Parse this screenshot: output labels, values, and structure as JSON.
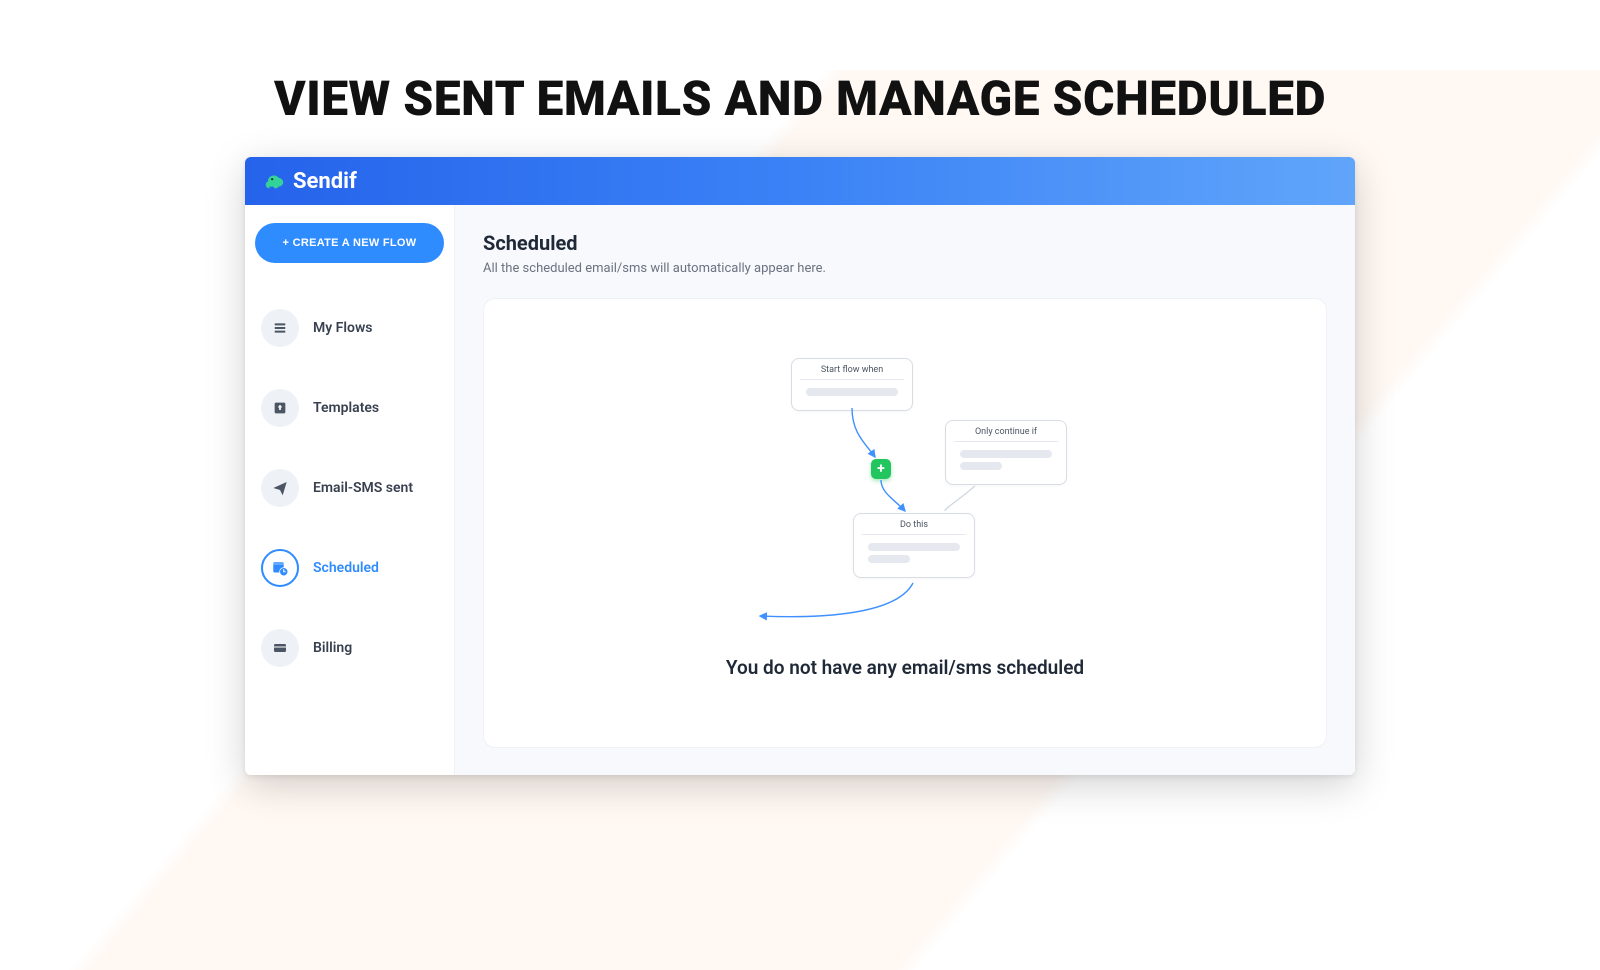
{
  "marketing": {
    "headline": "VIEW SENT EMAILS AND MANAGE SCHEDULED"
  },
  "header": {
    "brand": "Sendif"
  },
  "sidebar": {
    "create_button": "+ CREATE A NEW FLOW",
    "items": [
      {
        "id": "my-flows",
        "label": "My Flows",
        "icon": "stack-icon",
        "active": false
      },
      {
        "id": "templates",
        "label": "Templates",
        "icon": "upload-icon",
        "active": false
      },
      {
        "id": "email-sms-sent",
        "label": "Email-SMS sent",
        "icon": "paper-plane-icon",
        "active": false
      },
      {
        "id": "scheduled",
        "label": "Scheduled",
        "icon": "calendar-clock-icon",
        "active": true
      },
      {
        "id": "billing",
        "label": "Billing",
        "icon": "credit-card-icon",
        "active": false
      }
    ]
  },
  "main": {
    "title": "Scheduled",
    "subtitle": "All the scheduled email/sms will automatically appear here.",
    "illustration": {
      "card_start": "Start flow when",
      "card_condition": "Only continue if",
      "card_action": "Do this",
      "plus": "+"
    },
    "empty_message": "You do not have any email/sms scheduled"
  }
}
